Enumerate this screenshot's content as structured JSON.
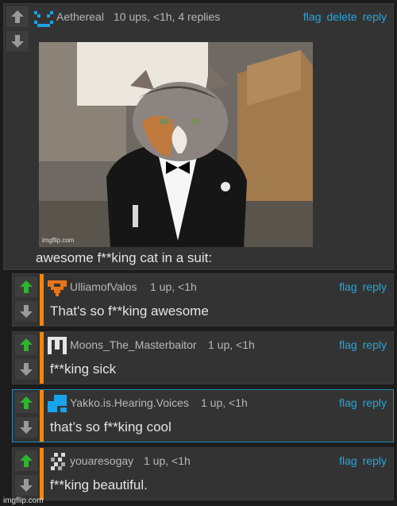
{
  "colors": {
    "background": "#1c1c1c",
    "link": "#20a8e0",
    "stripe": "#f0870d",
    "upvoted": "#2db52d",
    "highlight_border": "#1e8ab8"
  },
  "parent": {
    "username": "Aethereal",
    "stats": "10 ups, <1h, 4 replies",
    "actions": {
      "flag": "flag",
      "delete": "delete",
      "reply": "reply"
    },
    "image_watermark": "imgflip.com",
    "text": "awesome f**king cat in a suit:"
  },
  "replies": [
    {
      "username": "UlliamofValos",
      "stats": "1 up, <1h",
      "text": "That's so f**king awesome",
      "upvoted": true
    },
    {
      "username": "Moons_The_Masterbaitor",
      "stats": "1 up, <1h",
      "text": "f**king sick",
      "upvoted": true
    },
    {
      "username": "Yakko.is.Hearing.Voices",
      "stats": "1 up, <1h",
      "text": "that’s so f**king cool",
      "upvoted": true
    },
    {
      "username": "youaresogay",
      "stats": "1 up, <1h",
      "text": "f**king beautiful.",
      "upvoted": true
    }
  ],
  "reply_actions": {
    "flag": "flag",
    "reply": "reply"
  },
  "footer_watermark": "imgflip.com"
}
